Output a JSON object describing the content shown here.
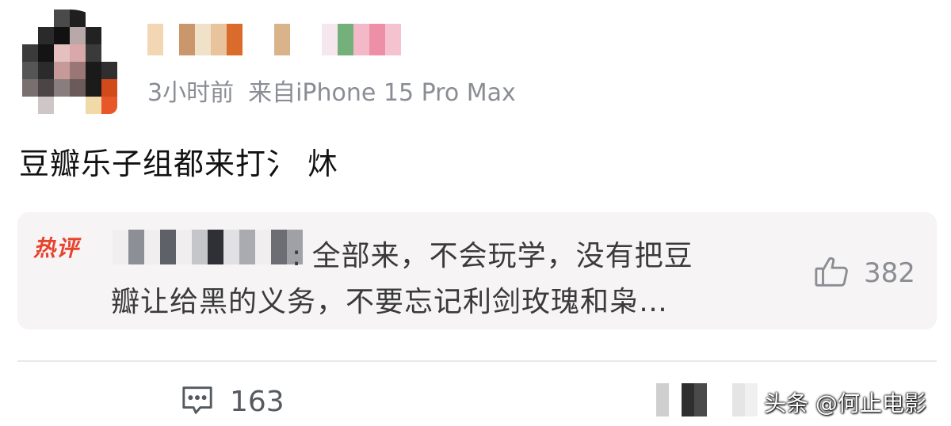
{
  "post": {
    "meta": {
      "time": "3小时前",
      "source": "来自iPhone 15 Pro Max"
    },
    "text": "豆瓣乐子组都来打氵 炑"
  },
  "hot_comment": {
    "badge": "热评",
    "text_line1": ": 全部来，不会玩学，没有把豆",
    "text_line2": "瓣让给黑的义务，不要忘记利剑玫瑰和枭…",
    "like_count": "382"
  },
  "footer": {
    "comment_count": "163"
  },
  "watermark": "头条 @何止电影",
  "icons": {
    "like": "thumbs-up-icon",
    "comment": "comment-icon"
  },
  "colors": {
    "hot_badge": "#e8432e",
    "meta_text": "#8a8d94",
    "hot_box_bg": "#f6f4f4"
  }
}
